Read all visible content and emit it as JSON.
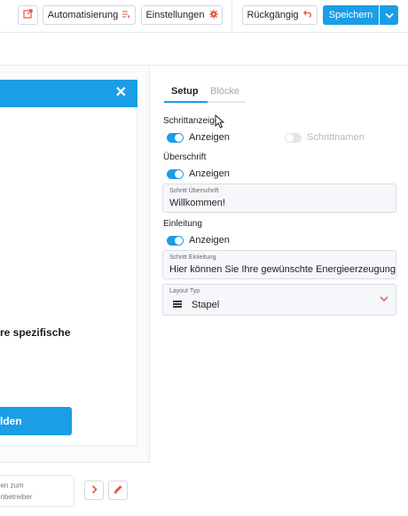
{
  "toolbar": {
    "automation_label": "Automatisierung",
    "settings_label": "Einstellungen",
    "undo_label": "Rückgängig",
    "save_label": "Speichern"
  },
  "icons": {
    "external": "external-link-icon",
    "automation": "list-lines-icon",
    "settings": "gear-icon",
    "undo": "undo-icon",
    "save_menu": "chevron-down-icon",
    "close": "close-icon",
    "next": "chevron-right-icon",
    "edit": "pencil-icon",
    "layout": "stack-icon",
    "select": "chevron-down-icon"
  },
  "preview": {
    "close_glyph": "✕",
    "body_text": "re spezifische",
    "cta_label": "lden",
    "step_card_line1": "ben zum",
    "step_card_line2": "enbetreiber"
  },
  "tabs": [
    {
      "label": "Setup",
      "active": true
    },
    {
      "label": "Blöcke",
      "active": false
    }
  ],
  "settings": {
    "step_display_label": "Schrittanzeige",
    "show_label": "Anzeigen",
    "step_names_label": "Schrittnamen",
    "heading_label": "Überschrift",
    "heading_field_label": "Schritt Überschrift",
    "heading_field_value": "Willkommen!",
    "intro_label": "Einleitung",
    "intro_field_label": "Schritt Einleitung",
    "intro_field_value": "Hier können Sie Ihre gewünschte Energieerzeugungs",
    "layout_field_label": "Layout Typ",
    "layout_field_value": "Stapel"
  },
  "colors": {
    "primary": "#1a9ee6",
    "accent_red": "#e8533c"
  }
}
